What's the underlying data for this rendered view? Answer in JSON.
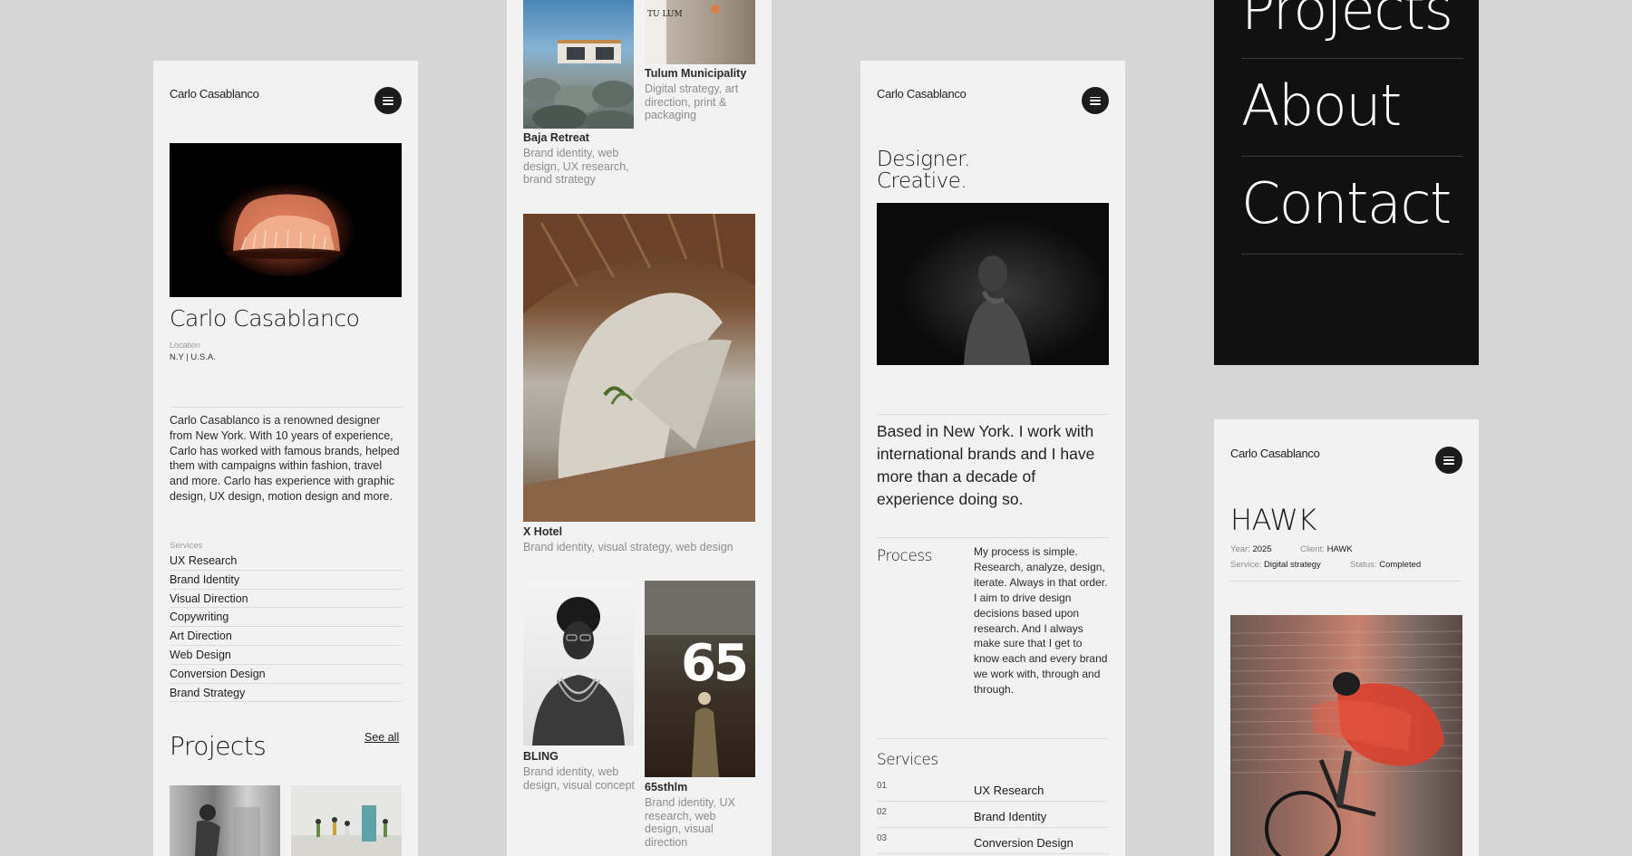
{
  "screen1": {
    "brand": "Carlo Casablanco",
    "name": "Carlo Casablanco",
    "location_label": "Location",
    "location": "N.Y | U.S.A.",
    "bio": "Carlo Casablanco is a renowned designer from New York. With 10 years of experience, Carlo has worked with famous brands, helped them with campaigns within fashion, travel and more. Carlo has experience with graphic design, UX design, motion design and more.",
    "services_label": "Services",
    "services": [
      "UX Research",
      "Brand Identity",
      "Visual Direction",
      "Copywriting",
      "Art Direction",
      "Web Design",
      "Conversion Design",
      "Brand Strategy"
    ],
    "projects_title": "Projects",
    "see_all": "See all"
  },
  "screen2": {
    "projects": [
      {
        "title": "Baja Retreat",
        "desc": "Brand identity, web design, UX research, brand strategy"
      },
      {
        "title": "Tulum Municipality",
        "desc": "Digital strategy, art direction, print & packaging"
      },
      {
        "title": "X Hotel",
        "desc": "Brand identity, visual strategy, web design"
      },
      {
        "title": "BLING",
        "desc": "Brand identity, web design, visual concept"
      },
      {
        "title": "65sthlm",
        "desc": "Brand identity, UX research, web design, visual direction"
      }
    ],
    "tulum_sign": "TU LUM",
    "poster_number": "65"
  },
  "screen3": {
    "brand": "Carlo Casablanco",
    "headline_1": "Designer.",
    "headline_2": "Creative.",
    "intro": "Based in New York. I work with international brands and I have more than a decade of experience doing so.",
    "process_title": "Process",
    "process_text": "My process is simple. Research, analyze, design, iterate. Always in that order. I aim to drive design decisions based upon research. And I always make sure that I get to know each and every brand we work with, through and through.",
    "services_title": "Services",
    "services": [
      {
        "num": "01",
        "label": "UX Research"
      },
      {
        "num": "02",
        "label": "Brand Identity"
      },
      {
        "num": "03",
        "label": "Conversion Design"
      }
    ]
  },
  "screen4": {
    "menu": [
      "Projects",
      "About",
      "Contact"
    ]
  },
  "screen5": {
    "brand": "Carlo Casablanco",
    "title": "HAWK",
    "year_label": "Year:",
    "year": "2025",
    "client_label": "Client:",
    "client": "HAWK",
    "service_label": "Service:",
    "service": "Digital strategy",
    "status_label": "Status:",
    "status": "Completed"
  }
}
